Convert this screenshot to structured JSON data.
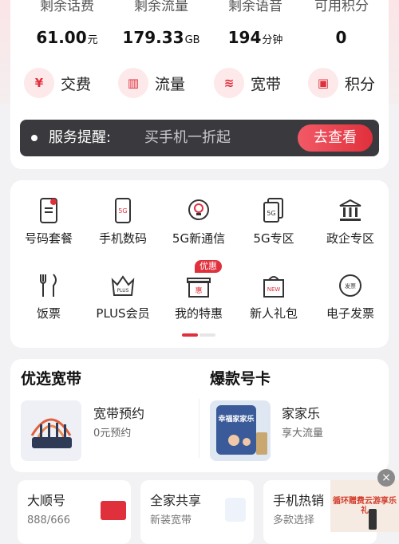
{
  "account_stats": [
    {
      "label": "剩余话费",
      "value": "61.00",
      "unit": "元"
    },
    {
      "label": "剩余流量",
      "value": "179.33",
      "unit": "GB"
    },
    {
      "label": "剩余语音",
      "value": "194",
      "unit": "分钟"
    },
    {
      "label": "可用积分",
      "value": "0",
      "unit": ""
    }
  ],
  "quick_actions": [
    {
      "label": "交费",
      "glyph": "¥",
      "icon": "yuan-icon"
    },
    {
      "label": "流量",
      "glyph": "▥",
      "icon": "data-chart-icon"
    },
    {
      "label": "宽带",
      "glyph": "≋",
      "icon": "router-icon"
    },
    {
      "label": "积分",
      "glyph": "▣",
      "icon": "points-icon"
    }
  ],
  "reminder": {
    "label": "服务提醒:",
    "text": "买手机一折起",
    "button": "去查看"
  },
  "service_grid": [
    {
      "label": "号码套餐",
      "icon": "sim-card-icon"
    },
    {
      "label": "手机数码",
      "icon": "phone-5g-icon"
    },
    {
      "label": "5G新通信",
      "icon": "lightbulb-icon"
    },
    {
      "label": "5G专区",
      "icon": "5g-stack-icon"
    },
    {
      "label": "政企专区",
      "icon": "building-icon"
    },
    {
      "label": "饭票",
      "icon": "fork-knife-icon"
    },
    {
      "label": "PLUS会员",
      "icon": "plus-crown-icon"
    },
    {
      "label": "我的特惠",
      "icon": "gift-box-icon"
    },
    {
      "label": "新人礼包",
      "icon": "new-gift-icon"
    },
    {
      "label": "电子发票",
      "icon": "invoice-icon"
    }
  ],
  "special_badge": "优惠",
  "box_glyphs": {
    "plus": "PLUS",
    "hui": "惠",
    "new": "NEW",
    "fapiao": "发票"
  },
  "sections": {
    "broadband": {
      "title": "优选宽带",
      "item_title": "宽带预约",
      "item_sub": "0元预约"
    },
    "hot_card": {
      "title": "爆款号卡",
      "item_title": "家家乐",
      "item_sub": "享大流量",
      "image_text": "幸福家家乐"
    }
  },
  "mini_cards": [
    {
      "title": "大顺号",
      "sub": "888/666"
    },
    {
      "title": "全家共享",
      "sub": "新装宽带"
    },
    {
      "title": "手机热销",
      "sub": "多款选择"
    }
  ],
  "float_ad": {
    "text": "循环赠费云游享乐礼",
    "close": "×"
  },
  "colors": {
    "accent": "#e0303c",
    "reminder_bg": "#3a3a3e"
  }
}
